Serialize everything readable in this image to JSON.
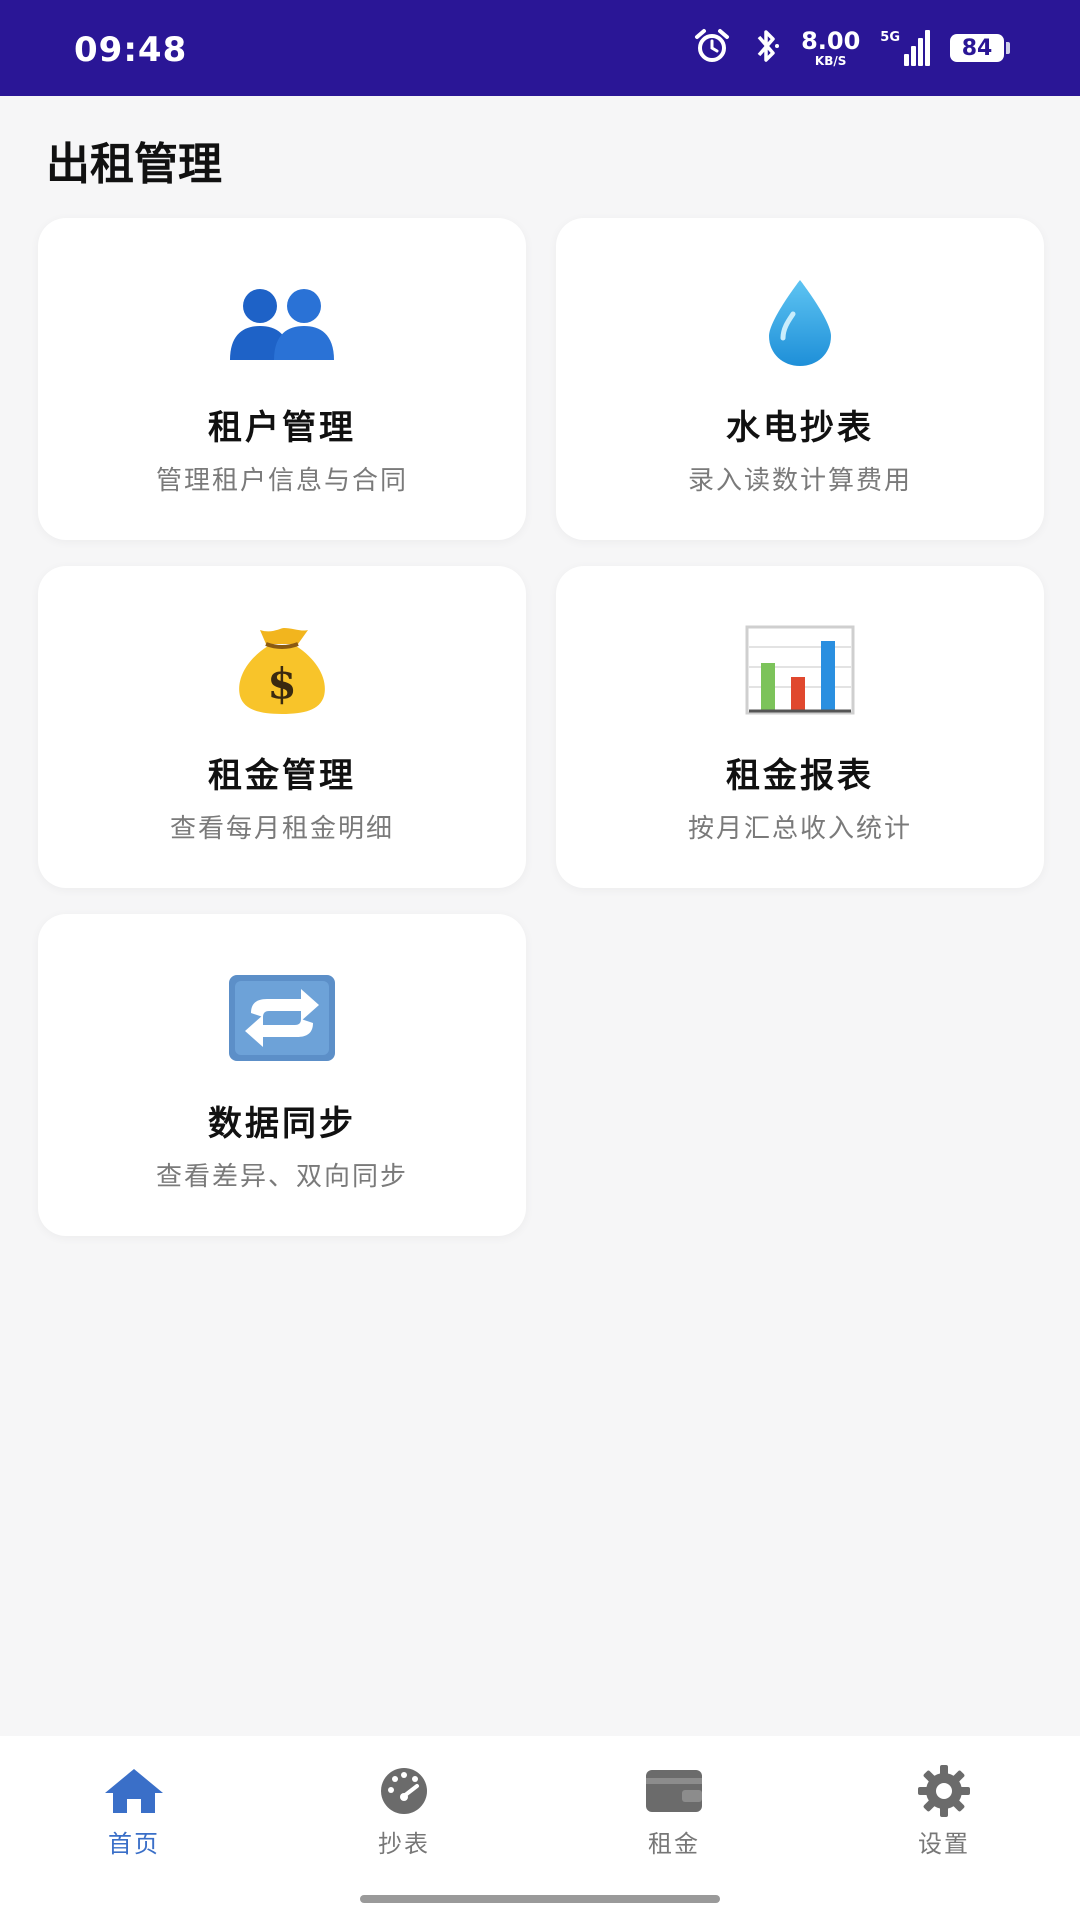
{
  "status_bar": {
    "time": "09:48",
    "net_speed_value": "8.00",
    "net_speed_unit": "KB/S",
    "signal_label": "5G",
    "battery": "84",
    "icons": [
      "alarm-icon",
      "bluetooth-icon",
      "signal-icon",
      "battery-icon"
    ]
  },
  "header": {
    "title": "出租管理"
  },
  "cards": [
    {
      "title": "租户管理",
      "subtitle": "管理租户信息与合同",
      "icon": "people-icon"
    },
    {
      "title": "水电抄表",
      "subtitle": "录入读数计算费用",
      "icon": "water-drop-icon"
    },
    {
      "title": "租金管理",
      "subtitle": "查看每月租金明细",
      "icon": "money-bag-icon"
    },
    {
      "title": "租金报表",
      "subtitle": "按月汇总收入统计",
      "icon": "bar-chart-icon"
    },
    {
      "title": "数据同步",
      "subtitle": "查看差异、双向同步",
      "icon": "sync-icon"
    }
  ],
  "bottom_nav": {
    "active": "首页",
    "items": [
      {
        "label": "首页",
        "icon": "home-icon"
      },
      {
        "label": "抄表",
        "icon": "meter-icon"
      },
      {
        "label": "租金",
        "icon": "wallet-icon"
      },
      {
        "label": "设置",
        "icon": "gear-icon"
      }
    ]
  },
  "colors": {
    "status_bar": "#2a1696",
    "active_nav": "#3a6fc8",
    "background": "#f6f6f7"
  }
}
